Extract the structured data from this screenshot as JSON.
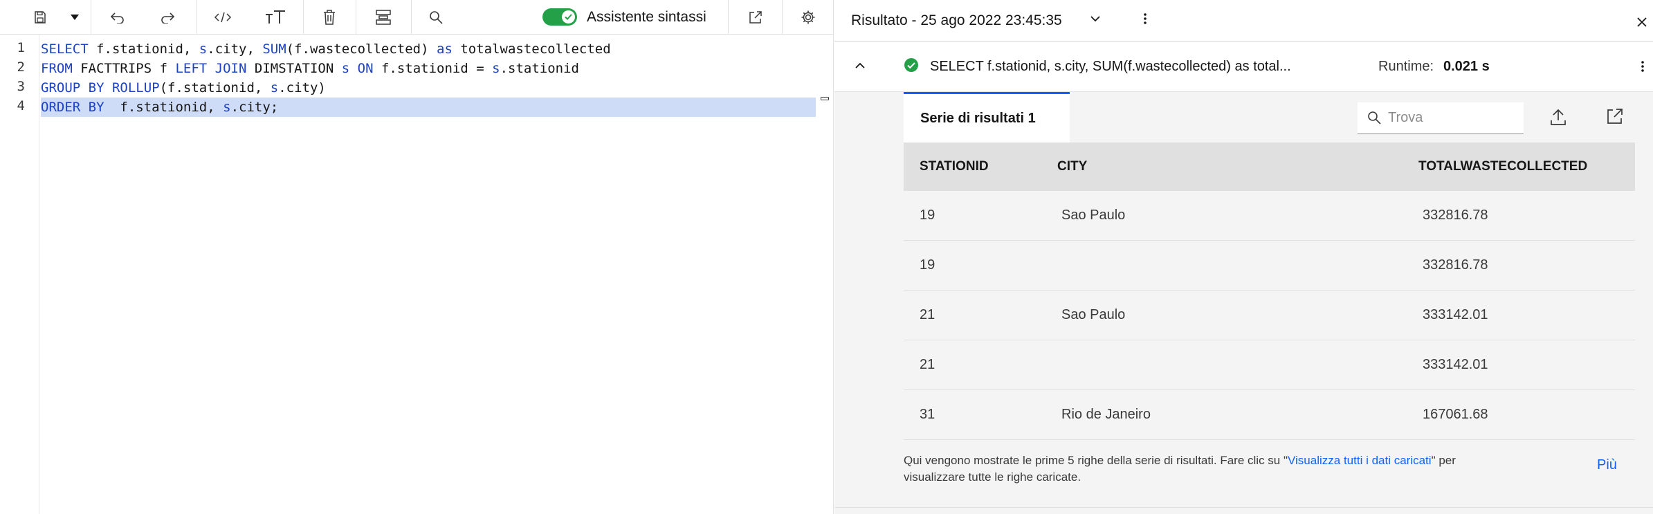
{
  "toggle": {
    "label": "Assistente sintassi",
    "on": true
  },
  "editor": {
    "lines": [
      {
        "no": "1",
        "tokens": [
          {
            "t": "SELECT",
            "k": "kw"
          },
          {
            "t": " f.stationid, "
          },
          {
            "t": "s",
            "k": "al"
          },
          {
            "t": ".city, "
          },
          {
            "t": "SUM",
            "k": "kw"
          },
          {
            "t": "(f.wastecollected) "
          },
          {
            "t": "as",
            "k": "kw"
          },
          {
            "t": " totalwastecollected"
          }
        ]
      },
      {
        "no": "2",
        "tokens": [
          {
            "t": "FROM",
            "k": "kw"
          },
          {
            "t": " FACTTRIPS f "
          },
          {
            "t": "LEFT JOIN",
            "k": "kw"
          },
          {
            "t": " DIMSTATION "
          },
          {
            "t": "s",
            "k": "al"
          },
          {
            "t": " "
          },
          {
            "t": "ON",
            "k": "kw"
          },
          {
            "t": " f.stationid = "
          },
          {
            "t": "s",
            "k": "al"
          },
          {
            "t": ".stationid"
          }
        ]
      },
      {
        "no": "3",
        "tokens": [
          {
            "t": "GROUP BY",
            "k": "kw"
          },
          {
            "t": " "
          },
          {
            "t": "ROLLUP",
            "k": "kw"
          },
          {
            "t": "(f.stationid, "
          },
          {
            "t": "s",
            "k": "al"
          },
          {
            "t": ".city)"
          }
        ]
      },
      {
        "no": "4",
        "tokens": [
          {
            "t": "ORDER BY",
            "k": "kw"
          },
          {
            "t": "  f.stationid, "
          },
          {
            "t": "s",
            "k": "al"
          },
          {
            "t": ".city;"
          }
        ]
      }
    ]
  },
  "results": {
    "title": "Risultato - 25 ago 2022 23:45:35",
    "query_preview": "SELECT f.stationid, s.city, SUM(f.wastecollected) as total...",
    "runtime_label": "Runtime:",
    "runtime_value": "0.021 s",
    "tab_label": "Serie di risultati 1",
    "search_placeholder": "Trova",
    "columns": [
      "STATIONID",
      "CITY",
      "TOTALWASTECOLLECTED"
    ],
    "rows": [
      [
        "19",
        "Sao Paulo",
        "332816.78"
      ],
      [
        "19",
        "",
        "332816.78"
      ],
      [
        "21",
        "Sao Paulo",
        "333142.01"
      ],
      [
        "21",
        "",
        "333142.01"
      ],
      [
        "31",
        "Rio de Janeiro",
        "167061.68"
      ]
    ],
    "footnote_before": "Qui vengono mostrate le prime 5 righe della serie di risultati. Fare clic su \"",
    "footnote_link": "Visualizza tutti i dati caricati",
    "footnote_after": "\" per visualizzare tutte le righe caricate.",
    "more_label": "Più"
  },
  "colors": {
    "accent": "#0f62fe",
    "toggle_on": "#24a148",
    "keyword": "#1d43c4",
    "selection": "#cfdcf7"
  }
}
